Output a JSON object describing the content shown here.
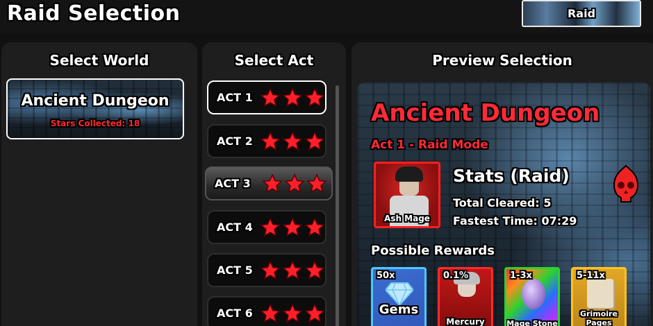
{
  "header": {
    "title": "Raid Selection",
    "mode_button_label": "Raid"
  },
  "world_panel": {
    "heading": "Select World",
    "world": {
      "name": "Ancient Dungeon",
      "stars_collected": "Stars Collected: 18"
    }
  },
  "act_panel": {
    "heading": "Select Act",
    "acts": [
      {
        "label": "ACT 1",
        "stars": 3
      },
      {
        "label": "ACT 2",
        "stars": 3
      },
      {
        "label": "ACT 3",
        "stars": 3
      },
      {
        "label": "ACT 4",
        "stars": 3
      },
      {
        "label": "ACT 5",
        "stars": 3
      },
      {
        "label": "ACT 6",
        "stars": 3
      }
    ],
    "selected_index": 0
  },
  "preview_panel": {
    "heading": "Preview Selection",
    "title": "Ancient Dungeon",
    "subtitle": "Act 1 - Raid Mode",
    "unit_name": "Ash Mage",
    "stats_title": "Stats (Raid)",
    "total_cleared": "Total Cleared: 5",
    "fastest_time": "Fastest Time: 07:29",
    "rewards_title": "Possible Rewards",
    "rewards": [
      {
        "qty": "50x",
        "name": "Gems"
      },
      {
        "qty": "0.1%",
        "name": "Mercury"
      },
      {
        "qty": "1-3x",
        "name": "Mage Stone"
      },
      {
        "qty": "5-11x",
        "name": "Grimoire Pages"
      }
    ]
  },
  "colors": {
    "accent_red": "#ff2a36",
    "star_red": "#ff1f2b"
  }
}
